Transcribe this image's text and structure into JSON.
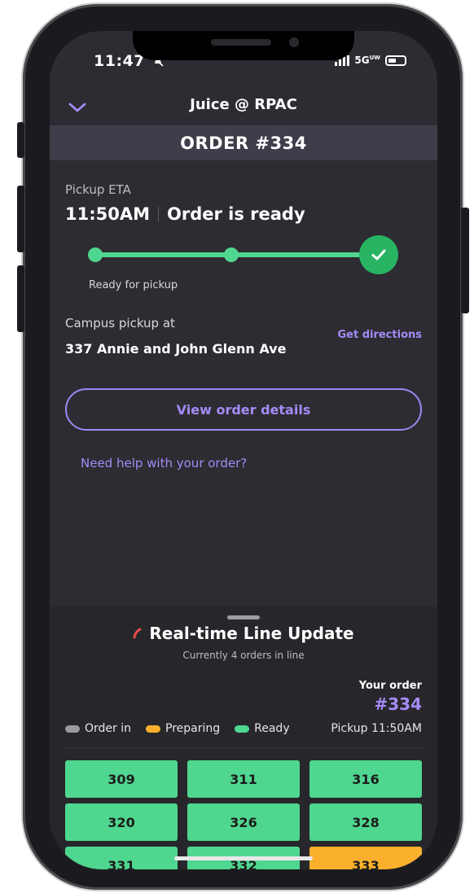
{
  "status_bar": {
    "time": "11:47",
    "network": "5G",
    "network_sub": "UW"
  },
  "header": {
    "title": "Juice @ RPAC"
  },
  "order": {
    "banner": "ORDER #334"
  },
  "eta": {
    "label": "Pickup ETA",
    "time": "11:50AM",
    "status": "Order is ready"
  },
  "progress": {
    "stage_label": "Ready for pickup",
    "completed_steps": 3,
    "total_steps": 3
  },
  "pickup": {
    "label": "Campus pickup at",
    "address": "337 Annie and John Glenn Ave",
    "directions_label": "Get directions"
  },
  "actions": {
    "view_details": "View order details",
    "help_link": "Need help with your order?"
  },
  "line_update": {
    "title": "Real-time Line Update",
    "subtitle": "Currently 4 orders in line",
    "your_order_label": "Your order",
    "your_order_number": "#334",
    "pickup_time": "Pickup 11:50AM",
    "legend": [
      {
        "label": "Order in",
        "color": "#9a9aa0"
      },
      {
        "label": "Preparing",
        "color": "#fbb02d"
      },
      {
        "label": "Ready",
        "color": "#4fd68f"
      }
    ],
    "orders": [
      {
        "number": "309",
        "state": "ready"
      },
      {
        "number": "311",
        "state": "ready"
      },
      {
        "number": "316",
        "state": "ready"
      },
      {
        "number": "320",
        "state": "ready"
      },
      {
        "number": "326",
        "state": "ready"
      },
      {
        "number": "328",
        "state": "ready"
      },
      {
        "number": "331",
        "state": "ready"
      },
      {
        "number": "332",
        "state": "ready"
      },
      {
        "number": "333",
        "state": "preparing"
      }
    ]
  },
  "colors": {
    "accent": "#a58bf7",
    "ready": "#4fd68f",
    "preparing": "#fbb02d",
    "check": "#28b463"
  }
}
